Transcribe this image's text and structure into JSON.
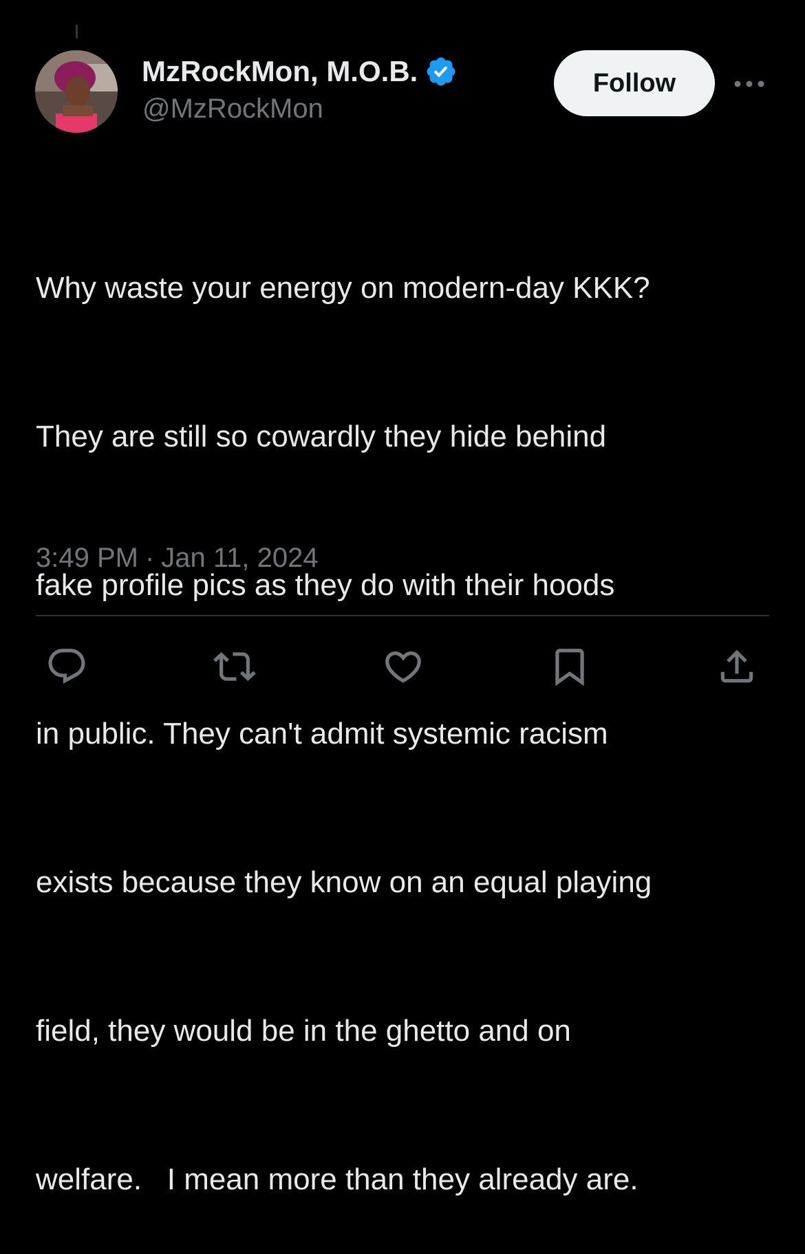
{
  "author": {
    "display_name": "MzRockMon, M.O.B.",
    "handle": "@MzRockMon",
    "verified": true,
    "avatar_icon": "avatar-photo"
  },
  "follow_label": "Follow",
  "tweet": {
    "lines": [
      "Why waste your energy on modern-day KKK?",
      "They are still so cowardly they hide behind",
      "fake profile pics as they do with their hoods",
      "in public. They can't admit systemic racism",
      "exists because they know on an equal playing",
      "field, they would be in the ghetto and on",
      "welfare.   I mean more than they already are."
    ],
    "time": "3:49 PM",
    "separator": "·",
    "date": "Jan 11, 2024"
  },
  "actions": [
    {
      "name": "reply",
      "icon": "reply-icon"
    },
    {
      "name": "repost",
      "icon": "repost-icon"
    },
    {
      "name": "like",
      "icon": "like-icon"
    },
    {
      "name": "bookmark",
      "icon": "bookmark-icon"
    },
    {
      "name": "share",
      "icon": "share-icon"
    }
  ],
  "colors": {
    "background": "#000000",
    "text_primary": "#e7e9ea",
    "text_secondary": "#71767b",
    "verified_blue": "#1d9bf0",
    "follow_bg": "#eff3f4",
    "divider": "#2f3336"
  }
}
